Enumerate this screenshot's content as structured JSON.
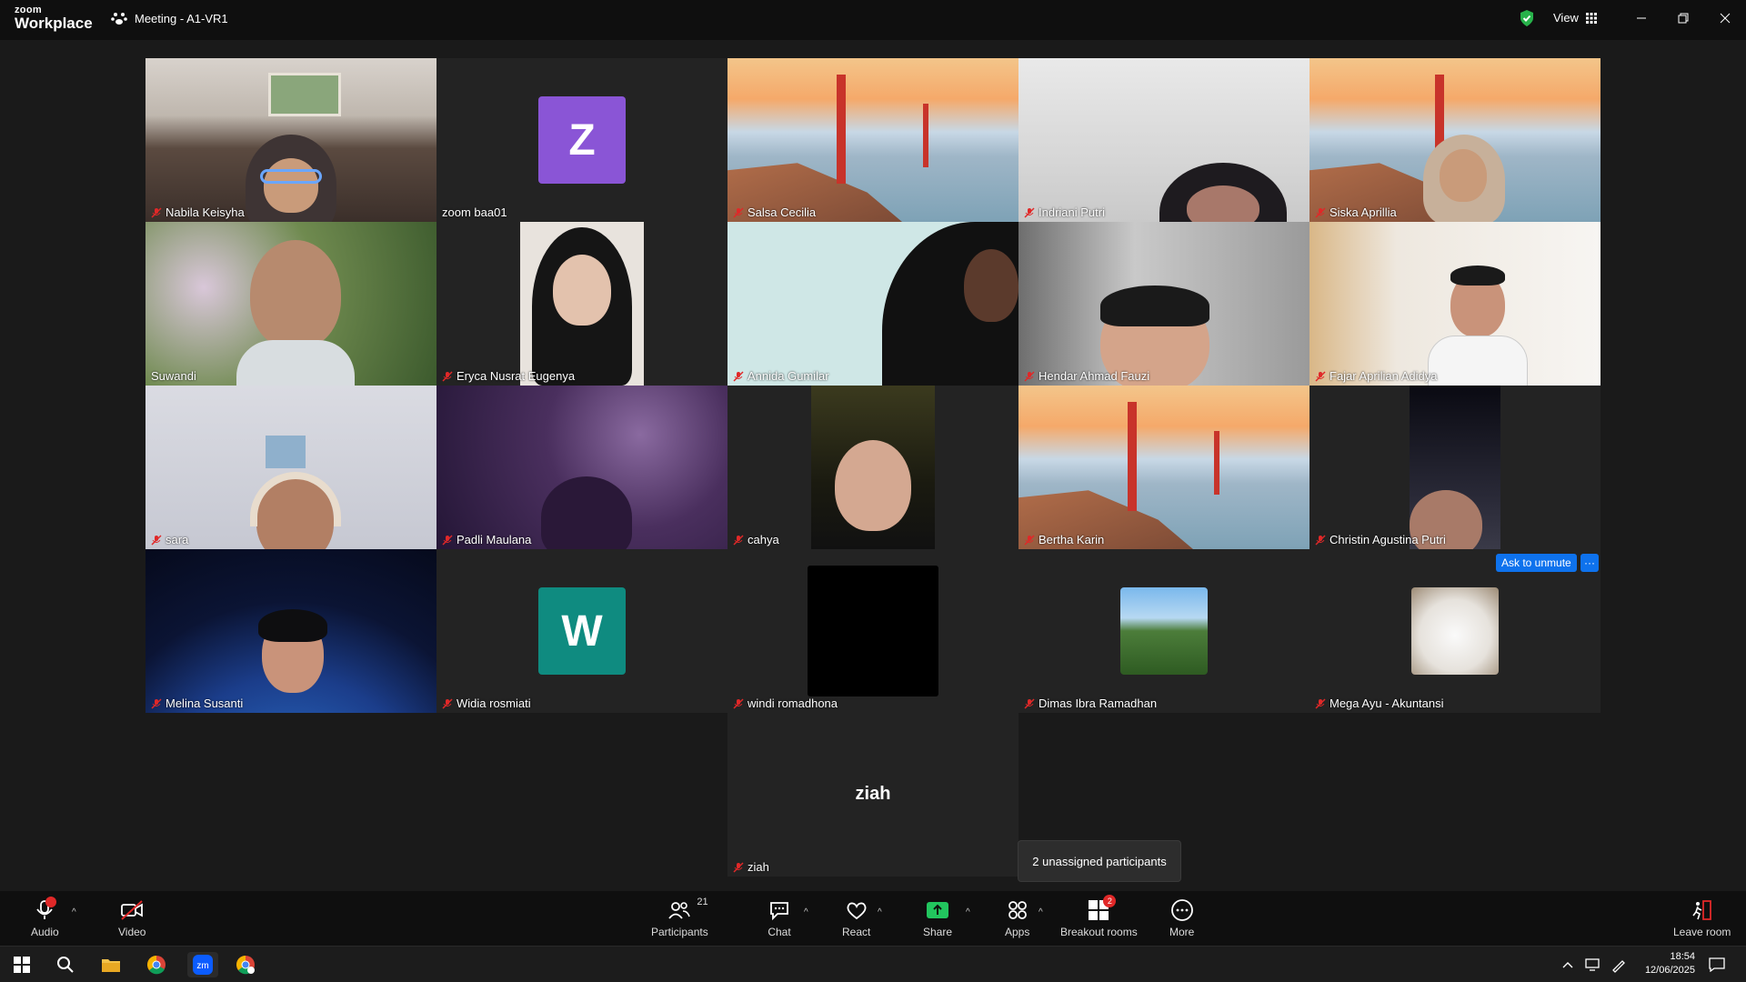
{
  "app": {
    "logo_top": "zoom",
    "logo_bottom": "Workplace",
    "meeting_title": "Meeting - A1-VR1",
    "view_label": "View"
  },
  "participants": [
    {
      "name": "Nabila Keisyha",
      "muted": true
    },
    {
      "name": "zoom baa01",
      "muted": false,
      "avatar_letter": "Z",
      "avatar_color": "#8a55d6"
    },
    {
      "name": "Salsa Cecilia",
      "muted": true
    },
    {
      "name": "Indriani Putri",
      "muted": true
    },
    {
      "name": "Siska Aprillia",
      "muted": true
    },
    {
      "name": "Suwandi",
      "muted": false,
      "speaking": true
    },
    {
      "name": "Eryca Nusrat Eugenya",
      "muted": true
    },
    {
      "name": "Annida Gumilar",
      "muted": true
    },
    {
      "name": "Hendar Ahmad Fauzi",
      "muted": true
    },
    {
      "name": "Fajar Aprilian Adidya",
      "muted": true
    },
    {
      "name": "sara",
      "muted": true
    },
    {
      "name": "Padli Maulana",
      "muted": true
    },
    {
      "name": "cahya",
      "muted": true
    },
    {
      "name": "Bertha Karin",
      "muted": true
    },
    {
      "name": "Christin Agustina Putri",
      "muted": true
    },
    {
      "name": "Melina Susanti",
      "muted": true
    },
    {
      "name": "Widia rosmiati",
      "muted": true,
      "avatar_letter": "W",
      "avatar_color": "#0f8b80"
    },
    {
      "name": "windi romadhona",
      "muted": true
    },
    {
      "name": "Dimas Ibra Ramadhan",
      "muted": true
    },
    {
      "name": "Mega Ayu - Akuntansi",
      "muted": true
    },
    {
      "name": "ziah",
      "muted": true,
      "display_name": "ziah"
    }
  ],
  "hover_actions": {
    "ask_to_unmute": "Ask to unmute",
    "more": "···"
  },
  "tooltip": "2 unassigned participants",
  "toolbar": {
    "audio": "Audio",
    "video": "Video",
    "participants": "Participants",
    "participants_count": "21",
    "chat": "Chat",
    "react": "React",
    "share": "Share",
    "apps": "Apps",
    "breakout": "Breakout rooms",
    "breakout_badge": "2",
    "more": "More",
    "leave": "Leave room"
  },
  "taskbar": {
    "time": "18:54",
    "date": "12/06/2025"
  },
  "colors": {
    "accent": "#0e72ed",
    "speaking": "#28d07a",
    "share": "#22c55e",
    "mute": "#e02828"
  }
}
